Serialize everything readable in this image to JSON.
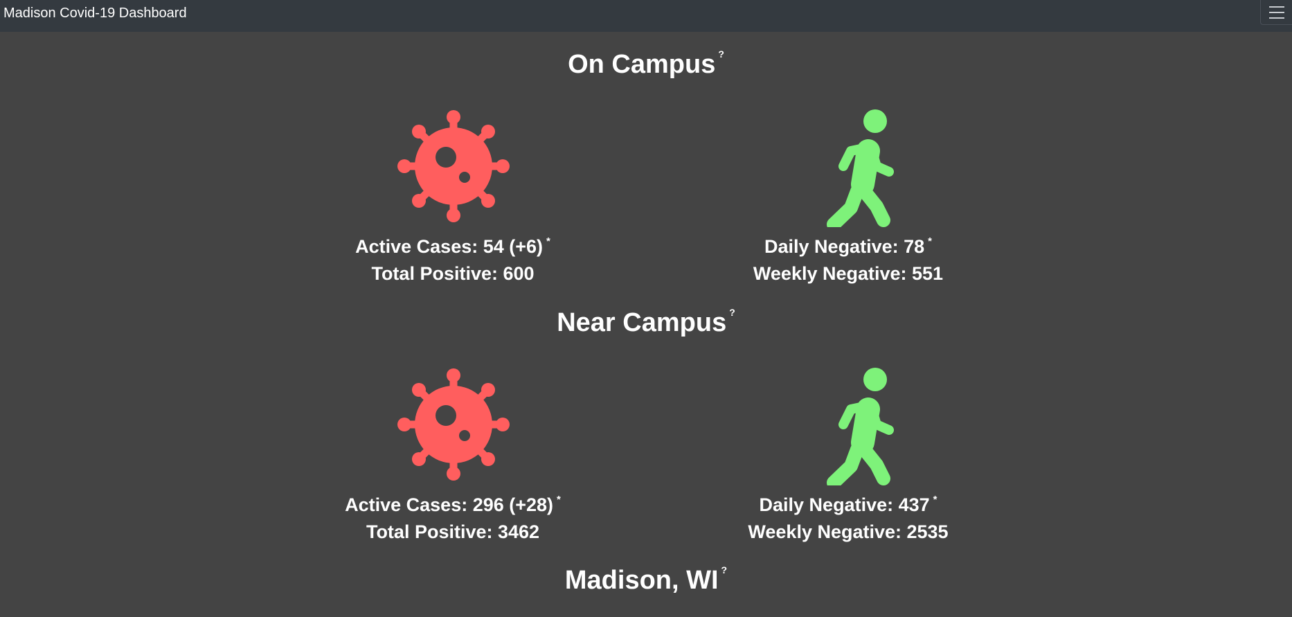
{
  "app": {
    "title": "Madison Covid-19 Dashboard",
    "menu_icon": "hamburger-menu-icon"
  },
  "help_marker": "?",
  "asterisk": "*",
  "colors": {
    "virus": "#ff5e5e",
    "walker": "#7ef27a",
    "background": "#444444",
    "navbar": "#343a40"
  },
  "sections": [
    {
      "title": "On Campus",
      "cases": {
        "icon": "virus-icon",
        "active_label": "Active Cases: 54 (+6)",
        "total_label": "Total Positive: 600"
      },
      "negatives": {
        "icon": "walking-person-icon",
        "daily_label": "Daily Negative: 78",
        "weekly_label": "Weekly Negative: 551"
      }
    },
    {
      "title": "Near Campus",
      "cases": {
        "icon": "virus-icon",
        "active_label": "Active Cases: 296 (+28)",
        "total_label": "Total Positive: 3462"
      },
      "negatives": {
        "icon": "walking-person-icon",
        "daily_label": "Daily Negative: 437",
        "weekly_label": "Weekly Negative: 2535"
      }
    },
    {
      "title": "Madison, WI"
    }
  ]
}
